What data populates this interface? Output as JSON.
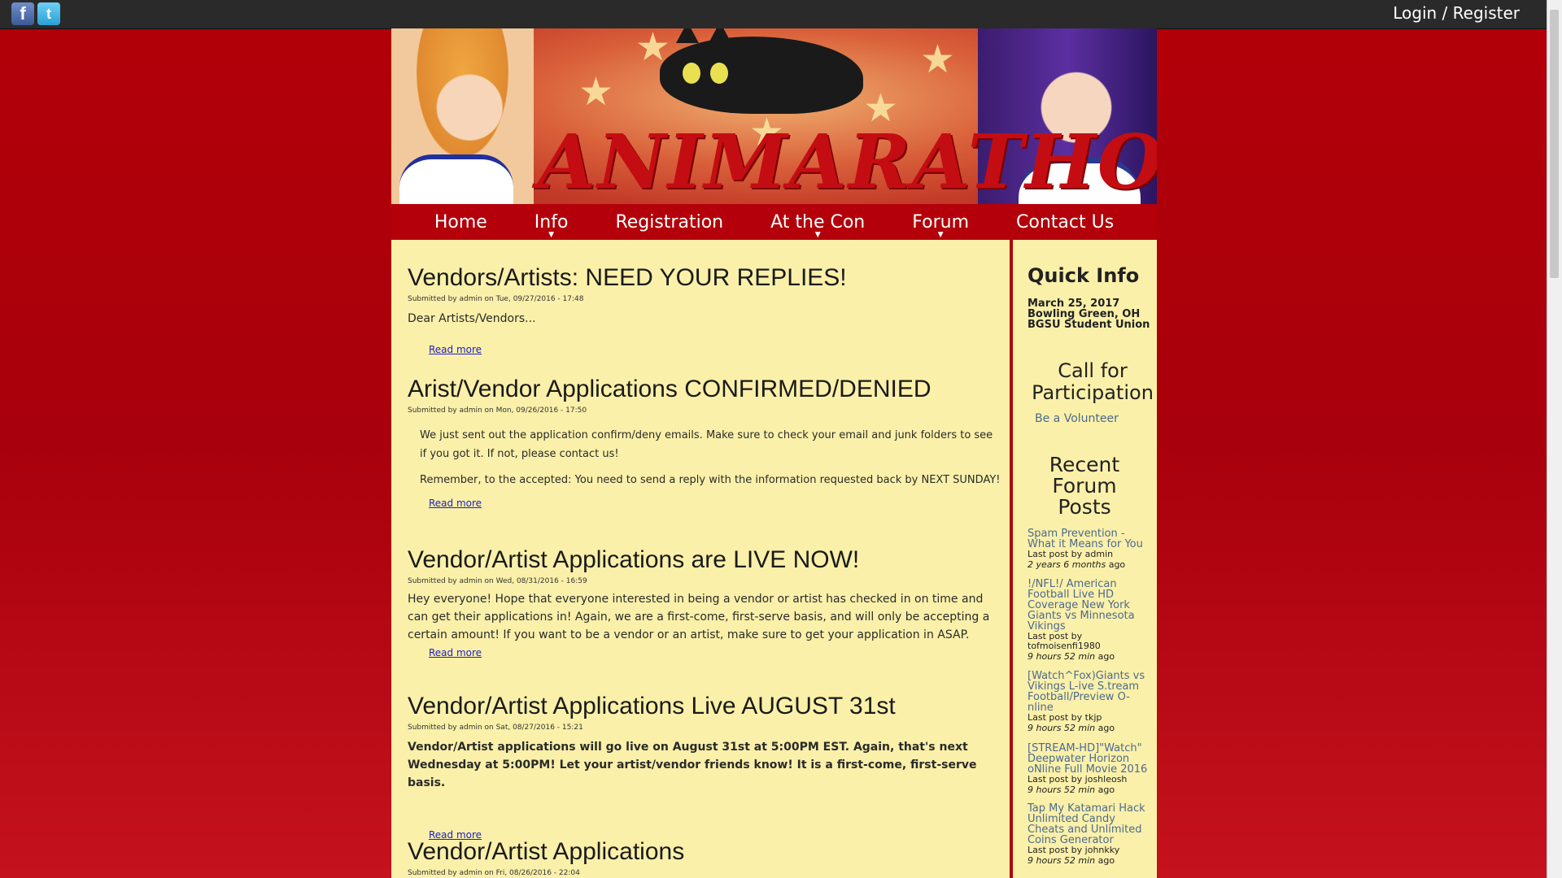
{
  "topbar": {
    "login_register": "Login / Register",
    "facebook_glyph": "f",
    "twitter_glyph": "t"
  },
  "banner": {
    "logo_text": "ANIMARATHON"
  },
  "nav": [
    {
      "label": "Home"
    },
    {
      "label": "Info"
    },
    {
      "label": "Registration"
    },
    {
      "label": "At the Con"
    },
    {
      "label": "Forum"
    },
    {
      "label": "Contact Us"
    }
  ],
  "articles": [
    {
      "title": "Vendors/Artists: NEED YOUR REPLIES!",
      "meta": "Submitted by admin on Tue, 09/27/2016 - 17:48",
      "body": "Dear Artists/Vendors...",
      "read_more": "Read more"
    },
    {
      "title": "Arist/Vendor Applications CONFIRMED/DENIED",
      "meta": "Submitted by admin on Mon, 09/26/2016 - 17:50",
      "body1": "We just sent out the application confirm/deny emails. Make sure to check your email and junk folders to see if you got it. If not, please contact us!",
      "body2": "Remember, to the accepted: You need to send a reply with the information requested back by NEXT SUNDAY!",
      "read_more": "Read more"
    },
    {
      "title": "Vendor/Artist Applications are LIVE NOW!",
      "meta": "Submitted by admin on Wed, 08/31/2016 - 16:59",
      "body": "Hey everyone! Hope that everyone interested in being a vendor or artist has checked in on time and can get their applications in! Again, we are a first-come, first-serve basis, and will only be accepting a certain amount! If you want to be a vendor or an artist, make sure to get your application in ASAP.",
      "read_more": "Read more"
    },
    {
      "title": "Vendor/Artist Applications Live AUGUST 31st",
      "meta": "Submitted by admin on Sat, 08/27/2016 - 15:21",
      "body": "Vendor/Artist applications will go live on August 31st at 5:00PM EST. Again, that's next Wednesday at 5:00PM! Let your artist/vendor friends know! It is a first-come, first-serve basis.",
      "read_more": "Read more"
    },
    {
      "title": "Vendor/Artist Applications",
      "meta": "Submitted by admin on Fri, 08/26/2016 - 22:04"
    }
  ],
  "sidebar": {
    "quick_info": {
      "title": "Quick Info",
      "date": "March 25, 2017",
      "city": "Bowling Green, OH",
      "venue": "BGSU Student Union"
    },
    "call_for_participation": {
      "title": "Call for Participation",
      "volunteer": "Be a Volunteer"
    },
    "recent_forum_posts": {
      "title": "Recent Forum Posts",
      "posts": [
        {
          "title": "Spam Prevention - What it Means for You",
          "last_post": "Last post by admin",
          "ago": "2 years 6 months",
          "suffix": "ago"
        },
        {
          "title": "!/NFL!/ American Football Live HD Coverage New York Giants vs Minnesota Vikings",
          "last_post": "Last post by tofmoisenfi1980",
          "ago": "9 hours 52 min",
          "suffix": "ago"
        },
        {
          "title": "[Watch^Fox)Giants vs Vikings L-ive S.tream Football/Preview O-nline",
          "last_post": "Last post by tkjp",
          "ago": "9 hours 52 min",
          "suffix": "ago"
        },
        {
          "title": "[STREAM-HD]\"Watch\" Deepwater Horizon oNline Full Movie 2016",
          "last_post": "Last post by joshleosh",
          "ago": "9 hours 52 min",
          "suffix": "ago"
        },
        {
          "title": "Tap My Katamari Hack Unlimited Candy Cheats and Unlimited Coins Generator",
          "last_post": "Last post by johnkky",
          "ago": "9 hours 52 min",
          "suffix": "ago"
        }
      ]
    }
  }
}
